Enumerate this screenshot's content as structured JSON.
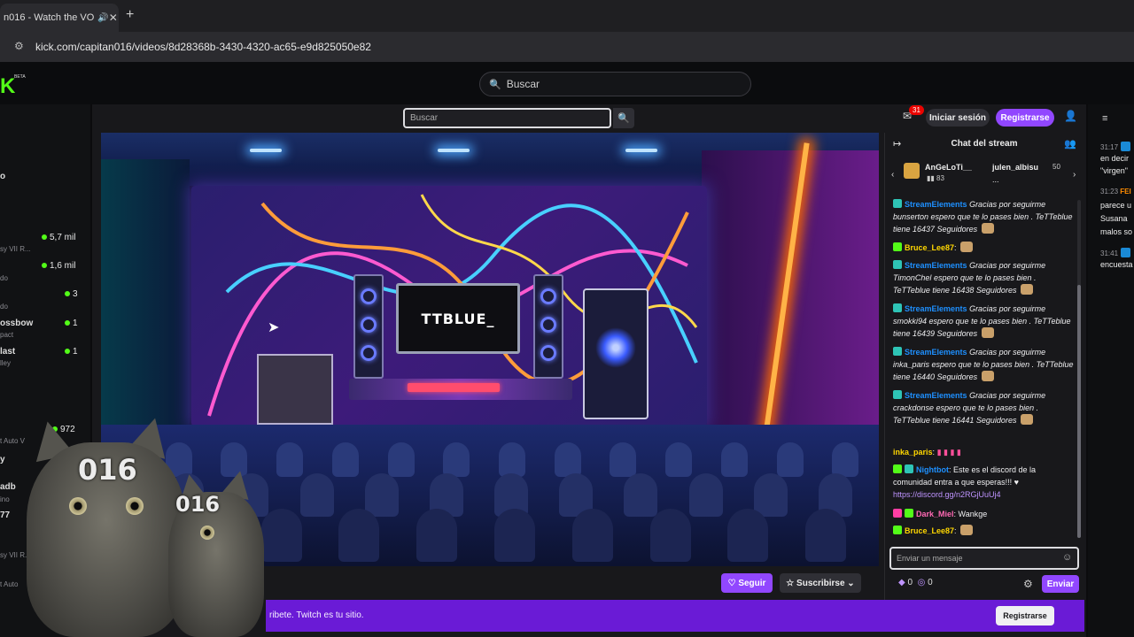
{
  "browser": {
    "tab_title": "n016 - Watch the VO",
    "url": "kick.com/capitan016/videos/8d28368b-3430-4320-ac65-e9d825050e82"
  },
  "kick": {
    "logo": "K",
    "beta": "BETA",
    "search_placeholder": "Buscar"
  },
  "left_sidebar": {
    "items": [
      {
        "label": "o",
        "sub": "",
        "count": ""
      },
      {
        "label": "",
        "sub": "",
        "count": "5,7 mil"
      },
      {
        "label": "",
        "sub": "sy VII R...",
        "count": ""
      },
      {
        "label": "",
        "sub": "",
        "count": "1,6 mil"
      },
      {
        "label": "",
        "sub": "do",
        "count": ""
      },
      {
        "label": "",
        "sub": "",
        "count": "3"
      },
      {
        "label": "",
        "sub": "do",
        "count": ""
      },
      {
        "label": "ossbow",
        "sub": "pact",
        "count": "1"
      },
      {
        "label": "last",
        "sub": "lley",
        "count": "1"
      },
      {
        "label": "",
        "sub": "",
        "count": "972"
      },
      {
        "label": "",
        "sub": "t Auto V",
        "count": ""
      },
      {
        "label": "y",
        "sub": "",
        "count": ""
      },
      {
        "label": "adb",
        "sub": "ino",
        "count": ""
      },
      {
        "label": "77",
        "sub": "",
        "count": ""
      },
      {
        "label": "",
        "sub": "sy VII R...",
        "count": ""
      },
      {
        "label": "",
        "sub": "t Auto",
        "count": ""
      }
    ]
  },
  "twitch": {
    "search_placeholder": "Buscar",
    "notif_count": "31",
    "login_label": "Iniciar sesión",
    "register_label": "Registrarse",
    "follow_label": "Seguir",
    "subscribe_label": "Suscribirse",
    "video_title_fragment": "...",
    "monitor_text": "TTBLUE_",
    "promo_text": "ribete. Twitch es tu sitio.",
    "promo_button": "Registrarse"
  },
  "overlay": {
    "cat_number_1": "016",
    "cat_number_2": "016"
  },
  "chat": {
    "title": "Chat del stream",
    "gifters": [
      {
        "name": "AnGeLoTi__",
        "amount": "83"
      },
      {
        "name": "julen_albisu",
        "amount": "50"
      },
      {
        "name": "...",
        "amount": ""
      }
    ],
    "messages": [
      {
        "user": "StreamElements",
        "color": "#1e90ff",
        "text": "Gracias por seguirme bunserton",
        "text2": "espero que te lo pases bien . TeTTeblue tiene 16437 Seguidores",
        "italic": true
      },
      {
        "user": "Bruce_Lee87",
        "color": "#ffd700",
        "text": ":",
        "text2": "",
        "italic": false
      },
      {
        "user": "StreamElements",
        "color": "#1e90ff",
        "text": "Gracias por seguirme TimonChel",
        "text2": "espero que te lo pases bien . TeTTeblue tiene 16438 Seguidores",
        "italic": true
      },
      {
        "user": "StreamElements",
        "color": "#1e90ff",
        "text": "Gracias por seguirme smokki94",
        "text2": "espero que te lo pases bien . TeTTeblue tiene 16439 Seguidores",
        "italic": true
      },
      {
        "user": "StreamElements",
        "color": "#1e90ff",
        "text": "Gracias por seguirme inka_paris",
        "text2": "espero que te lo pases bien . TeTTeblue tiene 16440 Seguidores",
        "italic": true
      },
      {
        "user": "StreamElements",
        "color": "#1e90ff",
        "text": "Gracias por seguirme crackdonse",
        "text2": "espero que te lo pases bien . TeTTeblue tiene 16441 Seguidores",
        "italic": true
      },
      {
        "user": "inka_paris",
        "color": "#ffd700",
        "text": ":",
        "text2": "",
        "italic": false
      },
      {
        "user": "Nightbot",
        "color": "#1e90ff",
        "text": ": Este es el discord de la comunidad entra a que esperas!!! ♥",
        "text2": "https://discord.gg/n2RGjUuUj4",
        "italic": false
      },
      {
        "user": "Dark_Miel",
        "color": "#ff69b4",
        "text": ": Wankge",
        "text2": "",
        "italic": false
      },
      {
        "user": "Bruce_Lee87",
        "color": "#ffd700",
        "text": ":",
        "text2": "",
        "italic": false
      }
    ],
    "input_placeholder": "Enviar un mensaje",
    "points_a": "0",
    "points_b": "0",
    "send_label": "Enviar"
  },
  "right_strip": {
    "entries": [
      {
        "time": "31:17",
        "lines": [
          "en decir",
          "\"virgen\""
        ]
      },
      {
        "time": "31:23",
        "name": "FEI",
        "lines": [
          "parece u",
          "Susana",
          "malos so"
        ]
      },
      {
        "time": "31:41",
        "lines": [
          "encuesta"
        ]
      }
    ]
  },
  "colors": {
    "kick_green": "#53fc18",
    "twitch_purple": "#9147ff",
    "promo_purple": "#6a1bd6"
  }
}
